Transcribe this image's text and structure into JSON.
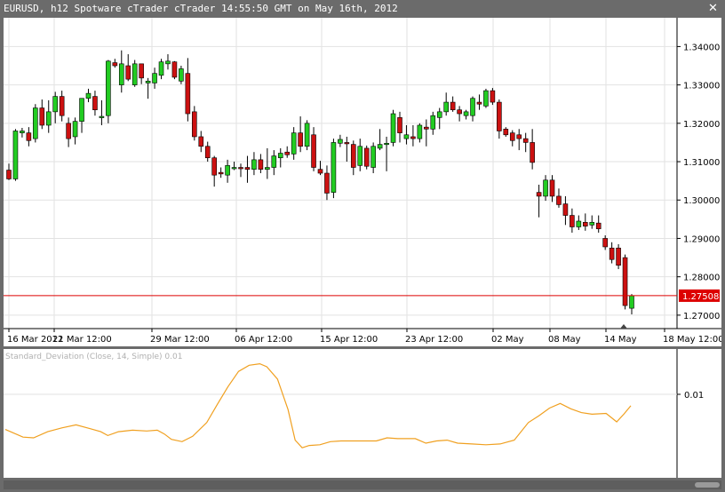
{
  "window": {
    "title": "EURUSD, h12 Spotware cTrader cTrader 14:55:50 GMT on May 16th, 2012",
    "close_icon": "close-icon"
  },
  "colors": {
    "bull": "#22cc22",
    "bear": "#cc1111",
    "wick": "#000000",
    "grid": "#e2e2e2",
    "price_line": "#dd0000",
    "indicator": "#f0a020"
  },
  "chart_data": [
    {
      "type": "candlestick",
      "symbol": "EURUSD",
      "timeframe": "h12",
      "ylim": [
        1.2665,
        1.3475
      ],
      "yticks": [
        "1.34000",
        "1.33000",
        "1.32000",
        "1.31000",
        "1.30000",
        "1.29000",
        "1.28000",
        "1.27000"
      ],
      "xtick_labels": [
        "16 Mar 2012",
        "21 Mar 12:00",
        "29 Mar 12:00",
        "06 Apr 12:00",
        "15 Apr 12:00",
        "23 Apr 12:00",
        "02 May",
        "08 May",
        "14 May",
        "18 May 12:00"
      ],
      "current_price": "1.27508",
      "candles": [
        {
          "o": 1.3078,
          "h": 1.3095,
          "l": 1.3052,
          "c": 1.3055
        },
        {
          "o": 1.3055,
          "h": 1.3185,
          "l": 1.305,
          "c": 1.318
        },
        {
          "o": 1.3175,
          "h": 1.3188,
          "l": 1.3163,
          "c": 1.318
        },
        {
          "o": 1.3175,
          "h": 1.319,
          "l": 1.314,
          "c": 1.3155
        },
        {
          "o": 1.316,
          "h": 1.325,
          "l": 1.315,
          "c": 1.324
        },
        {
          "o": 1.324,
          "h": 1.3262,
          "l": 1.3185,
          "c": 1.3195
        },
        {
          "o": 1.3195,
          "h": 1.326,
          "l": 1.3175,
          "c": 1.323
        },
        {
          "o": 1.323,
          "h": 1.3282,
          "l": 1.32,
          "c": 1.327
        },
        {
          "o": 1.327,
          "h": 1.3285,
          "l": 1.3205,
          "c": 1.322
        },
        {
          "o": 1.32,
          "h": 1.3215,
          "l": 1.3138,
          "c": 1.316
        },
        {
          "o": 1.3165,
          "h": 1.3215,
          "l": 1.3145,
          "c": 1.3205
        },
        {
          "o": 1.3205,
          "h": 1.3258,
          "l": 1.3175,
          "c": 1.3265
        },
        {
          "o": 1.3265,
          "h": 1.329,
          "l": 1.3255,
          "c": 1.3278
        },
        {
          "o": 1.327,
          "h": 1.3285,
          "l": 1.322,
          "c": 1.3235
        },
        {
          "o": 1.3215,
          "h": 1.326,
          "l": 1.3195,
          "c": 1.3218
        },
        {
          "o": 1.322,
          "h": 1.3365,
          "l": 1.32,
          "c": 1.3362
        },
        {
          "o": 1.3358,
          "h": 1.3368,
          "l": 1.3345,
          "c": 1.335
        },
        {
          "o": 1.33,
          "h": 1.339,
          "l": 1.328,
          "c": 1.3355
        },
        {
          "o": 1.335,
          "h": 1.338,
          "l": 1.331,
          "c": 1.3315
        },
        {
          "o": 1.33,
          "h": 1.3365,
          "l": 1.3295,
          "c": 1.3355
        },
        {
          "o": 1.3355,
          "h": 1.3355,
          "l": 1.3302,
          "c": 1.3318
        },
        {
          "o": 1.3305,
          "h": 1.3318,
          "l": 1.3264,
          "c": 1.331
        },
        {
          "o": 1.3305,
          "h": 1.3345,
          "l": 1.329,
          "c": 1.333
        },
        {
          "o": 1.3325,
          "h": 1.3368,
          "l": 1.3315,
          "c": 1.336
        },
        {
          "o": 1.3355,
          "h": 1.338,
          "l": 1.334,
          "c": 1.3362
        },
        {
          "o": 1.336,
          "h": 1.3362,
          "l": 1.3315,
          "c": 1.332
        },
        {
          "o": 1.331,
          "h": 1.335,
          "l": 1.3302,
          "c": 1.3342
        },
        {
          "o": 1.333,
          "h": 1.337,
          "l": 1.3205,
          "c": 1.3225
        },
        {
          "o": 1.323,
          "h": 1.3245,
          "l": 1.3155,
          "c": 1.3165
        },
        {
          "o": 1.3165,
          "h": 1.318,
          "l": 1.3125,
          "c": 1.314
        },
        {
          "o": 1.314,
          "h": 1.3152,
          "l": 1.31,
          "c": 1.311
        },
        {
          "o": 1.311,
          "h": 1.3115,
          "l": 1.3035,
          "c": 1.3065
        },
        {
          "o": 1.3072,
          "h": 1.3085,
          "l": 1.3058,
          "c": 1.3068
        },
        {
          "o": 1.3065,
          "h": 1.3105,
          "l": 1.3045,
          "c": 1.309
        },
        {
          "o": 1.3085,
          "h": 1.31,
          "l": 1.3078,
          "c": 1.3085
        },
        {
          "o": 1.3085,
          "h": 1.3095,
          "l": 1.306,
          "c": 1.3082
        },
        {
          "o": 1.3085,
          "h": 1.3115,
          "l": 1.3045,
          "c": 1.308
        },
        {
          "o": 1.308,
          "h": 1.3125,
          "l": 1.3065,
          "c": 1.3105
        },
        {
          "o": 1.3105,
          "h": 1.312,
          "l": 1.307,
          "c": 1.308
        },
        {
          "o": 1.308,
          "h": 1.3135,
          "l": 1.3055,
          "c": 1.3085
        },
        {
          "o": 1.3085,
          "h": 1.313,
          "l": 1.3065,
          "c": 1.3115
        },
        {
          "o": 1.311,
          "h": 1.3135,
          "l": 1.3085,
          "c": 1.3122
        },
        {
          "o": 1.3125,
          "h": 1.314,
          "l": 1.311,
          "c": 1.3118
        },
        {
          "o": 1.312,
          "h": 1.319,
          "l": 1.3105,
          "c": 1.3175
        },
        {
          "o": 1.3175,
          "h": 1.3218,
          "l": 1.3125,
          "c": 1.314
        },
        {
          "o": 1.314,
          "h": 1.3208,
          "l": 1.313,
          "c": 1.32
        },
        {
          "o": 1.317,
          "h": 1.319,
          "l": 1.3075,
          "c": 1.3085
        },
        {
          "o": 1.308,
          "h": 1.3102,
          "l": 1.3065,
          "c": 1.307
        },
        {
          "o": 1.307,
          "h": 1.309,
          "l": 1.3,
          "c": 1.3018
        },
        {
          "o": 1.302,
          "h": 1.316,
          "l": 1.3005,
          "c": 1.315
        },
        {
          "o": 1.3148,
          "h": 1.317,
          "l": 1.3138,
          "c": 1.3158
        },
        {
          "o": 1.315,
          "h": 1.3165,
          "l": 1.31,
          "c": 1.3148
        },
        {
          "o": 1.3145,
          "h": 1.3155,
          "l": 1.3065,
          "c": 1.3085
        },
        {
          "o": 1.309,
          "h": 1.316,
          "l": 1.3075,
          "c": 1.314
        },
        {
          "o": 1.3135,
          "h": 1.3142,
          "l": 1.308,
          "c": 1.3088
        },
        {
          "o": 1.3085,
          "h": 1.315,
          "l": 1.307,
          "c": 1.314
        },
        {
          "o": 1.3135,
          "h": 1.3185,
          "l": 1.313,
          "c": 1.3145
        },
        {
          "o": 1.3145,
          "h": 1.3165,
          "l": 1.3075,
          "c": 1.3148
        },
        {
          "o": 1.315,
          "h": 1.3235,
          "l": 1.314,
          "c": 1.3225
        },
        {
          "o": 1.3215,
          "h": 1.323,
          "l": 1.315,
          "c": 1.3175
        },
        {
          "o": 1.316,
          "h": 1.3195,
          "l": 1.3145,
          "c": 1.317
        },
        {
          "o": 1.3165,
          "h": 1.3195,
          "l": 1.314,
          "c": 1.316
        },
        {
          "o": 1.316,
          "h": 1.32,
          "l": 1.315,
          "c": 1.3195
        },
        {
          "o": 1.319,
          "h": 1.321,
          "l": 1.314,
          "c": 1.3185
        },
        {
          "o": 1.3185,
          "h": 1.323,
          "l": 1.317,
          "c": 1.322
        },
        {
          "o": 1.3215,
          "h": 1.324,
          "l": 1.3185,
          "c": 1.323
        },
        {
          "o": 1.323,
          "h": 1.328,
          "l": 1.322,
          "c": 1.3255
        },
        {
          "o": 1.3255,
          "h": 1.327,
          "l": 1.323,
          "c": 1.3235
        },
        {
          "o": 1.3235,
          "h": 1.3245,
          "l": 1.3205,
          "c": 1.3225
        },
        {
          "o": 1.322,
          "h": 1.3235,
          "l": 1.321,
          "c": 1.323
        },
        {
          "o": 1.322,
          "h": 1.327,
          "l": 1.3205,
          "c": 1.3265
        },
        {
          "o": 1.3255,
          "h": 1.3275,
          "l": 1.3235,
          "c": 1.325
        },
        {
          "o": 1.3245,
          "h": 1.329,
          "l": 1.324,
          "c": 1.3285
        },
        {
          "o": 1.3285,
          "h": 1.3292,
          "l": 1.3248,
          "c": 1.3255
        },
        {
          "o": 1.3255,
          "h": 1.3262,
          "l": 1.316,
          "c": 1.318
        },
        {
          "o": 1.3185,
          "h": 1.319,
          "l": 1.3165,
          "c": 1.317
        },
        {
          "o": 1.3175,
          "h": 1.3182,
          "l": 1.314,
          "c": 1.3155
        },
        {
          "o": 1.317,
          "h": 1.3185,
          "l": 1.313,
          "c": 1.316
        },
        {
          "o": 1.316,
          "h": 1.3175,
          "l": 1.3125,
          "c": 1.315
        },
        {
          "o": 1.315,
          "h": 1.3185,
          "l": 1.308,
          "c": 1.3098
        },
        {
          "o": 1.302,
          "h": 1.304,
          "l": 1.2955,
          "c": 1.301
        },
        {
          "o": 1.301,
          "h": 1.3065,
          "l": 1.2998,
          "c": 1.3052
        },
        {
          "o": 1.3052,
          "h": 1.3065,
          "l": 1.2995,
          "c": 1.301
        },
        {
          "o": 1.301,
          "h": 1.303,
          "l": 1.298,
          "c": 1.2988
        },
        {
          "o": 1.299,
          "h": 1.301,
          "l": 1.2935,
          "c": 1.296
        },
        {
          "o": 1.296,
          "h": 1.2978,
          "l": 1.2915,
          "c": 1.293
        },
        {
          "o": 1.293,
          "h": 1.296,
          "l": 1.2922,
          "c": 1.2945
        },
        {
          "o": 1.2942,
          "h": 1.2965,
          "l": 1.292,
          "c": 1.2932
        },
        {
          "o": 1.2935,
          "h": 1.296,
          "l": 1.2925,
          "c": 1.2942
        },
        {
          "o": 1.294,
          "h": 1.296,
          "l": 1.2915,
          "c": 1.2925
        },
        {
          "o": 1.29,
          "h": 1.2908,
          "l": 1.287,
          "c": 1.2878
        },
        {
          "o": 1.2875,
          "h": 1.289,
          "l": 1.2835,
          "c": 1.2845
        },
        {
          "o": 1.2875,
          "h": 1.2885,
          "l": 1.282,
          "c": 1.283
        },
        {
          "o": 1.285,
          "h": 1.2858,
          "l": 1.2715,
          "c": 1.2725
        },
        {
          "o": 1.2718,
          "h": 1.2755,
          "l": 1.2702,
          "c": 1.2751
        }
      ]
    },
    {
      "type": "line",
      "label": "Standard_Deviation (Close, 14, Simple) 0.01",
      "ytick": "0.01",
      "series": [
        {
          "x": 0,
          "y": 0.0054
        },
        {
          "x": 5,
          "y": 0.0044
        },
        {
          "x": 8,
          "y": 0.0043
        },
        {
          "x": 12,
          "y": 0.0051
        },
        {
          "x": 16,
          "y": 0.0056
        },
        {
          "x": 20,
          "y": 0.006
        },
        {
          "x": 24,
          "y": 0.0055
        },
        {
          "x": 27,
          "y": 0.0051
        },
        {
          "x": 29,
          "y": 0.0046
        },
        {
          "x": 32,
          "y": 0.0051
        },
        {
          "x": 36,
          "y": 0.0053
        },
        {
          "x": 40,
          "y": 0.0052
        },
        {
          "x": 43,
          "y": 0.0053
        },
        {
          "x": 45,
          "y": 0.0048
        },
        {
          "x": 47,
          "y": 0.0041
        },
        {
          "x": 50,
          "y": 0.0038
        },
        {
          "x": 53,
          "y": 0.0045
        },
        {
          "x": 57,
          "y": 0.0063
        },
        {
          "x": 60,
          "y": 0.0087
        },
        {
          "x": 63,
          "y": 0.011
        },
        {
          "x": 66,
          "y": 0.013
        },
        {
          "x": 69,
          "y": 0.0138
        },
        {
          "x": 72,
          "y": 0.014
        },
        {
          "x": 74,
          "y": 0.0136
        },
        {
          "x": 77,
          "y": 0.012
        },
        {
          "x": 80,
          "y": 0.008
        },
        {
          "x": 82,
          "y": 0.004
        },
        {
          "x": 84,
          "y": 0.003
        },
        {
          "x": 86,
          "y": 0.0033
        },
        {
          "x": 89,
          "y": 0.0034
        },
        {
          "x": 92,
          "y": 0.0038
        },
        {
          "x": 95,
          "y": 0.0039
        },
        {
          "x": 100,
          "y": 0.0039
        },
        {
          "x": 105,
          "y": 0.0039
        },
        {
          "x": 108,
          "y": 0.0043
        },
        {
          "x": 111,
          "y": 0.0042
        },
        {
          "x": 116,
          "y": 0.0042
        },
        {
          "x": 119,
          "y": 0.0036
        },
        {
          "x": 122,
          "y": 0.0039
        },
        {
          "x": 125,
          "y": 0.004
        },
        {
          "x": 128,
          "y": 0.0036
        },
        {
          "x": 132,
          "y": 0.0035
        },
        {
          "x": 136,
          "y": 0.0034
        },
        {
          "x": 140,
          "y": 0.0035
        },
        {
          "x": 144,
          "y": 0.004
        },
        {
          "x": 148,
          "y": 0.0063
        },
        {
          "x": 151,
          "y": 0.0072
        },
        {
          "x": 154,
          "y": 0.0082
        },
        {
          "x": 157,
          "y": 0.0088
        },
        {
          "x": 160,
          "y": 0.0081
        },
        {
          "x": 163,
          "y": 0.0076
        },
        {
          "x": 166,
          "y": 0.0074
        },
        {
          "x": 170,
          "y": 0.0075
        },
        {
          "x": 173,
          "y": 0.0064
        },
        {
          "x": 175,
          "y": 0.0074
        },
        {
          "x": 177,
          "y": 0.0085
        }
      ],
      "xmax": 178,
      "ylim": [
        0.0,
        0.015
      ]
    }
  ]
}
